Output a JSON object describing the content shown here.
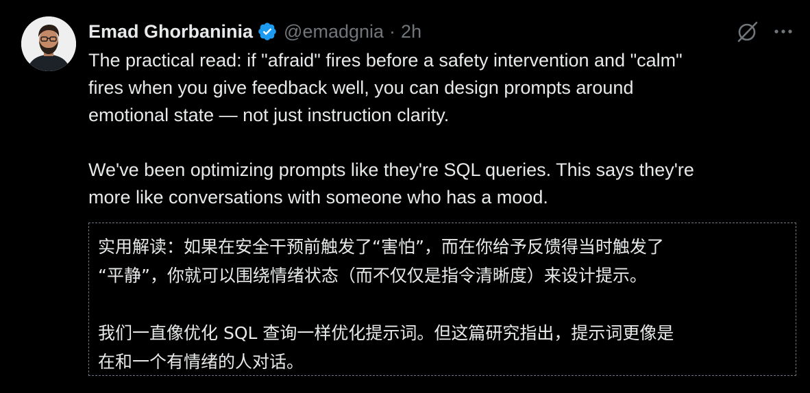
{
  "tweet": {
    "author": {
      "display_name": "Emad Ghorbaninia",
      "handle": "@emadgnia",
      "separator": "·",
      "timestamp": "2h",
      "verified": true
    },
    "actions": {
      "grok_icon": "grok-icon",
      "more_icon": "more-horizontal-icon"
    },
    "body": {
      "paragraph1_line1": "The practical read: if \"afraid\" fires before a safety intervention and \"calm\"",
      "paragraph1_line2": "fires when you give feedback well, you can design prompts around",
      "paragraph1_line3": "emotional state — not just instruction clarity.",
      "paragraph2_line1": "We've been optimizing prompts like they're SQL queries. This says they're",
      "paragraph2_line2": "more like conversations with someone who has a mood."
    },
    "translation": {
      "paragraph1_line1": "实用解读：如果在安全干预前触发了“害怕”，而在你给予反馈得当时触发了",
      "paragraph1_line2": "“平静”，你就可以围绕情绪状态（而不仅仅是指令清晰度）来设计提示。",
      "paragraph2_line1": "我们一直像优化 SQL 查询一样优化提示词。但这篇研究指出，提示词更像是",
      "paragraph2_line2": "在和一个有情绪的人对话。"
    }
  },
  "colors": {
    "background": "#000000",
    "primary_text": "#e7e9ea",
    "secondary_text": "#71767b",
    "verified_blue": "#1d9bf0",
    "dashed_border": "#6e7681"
  }
}
